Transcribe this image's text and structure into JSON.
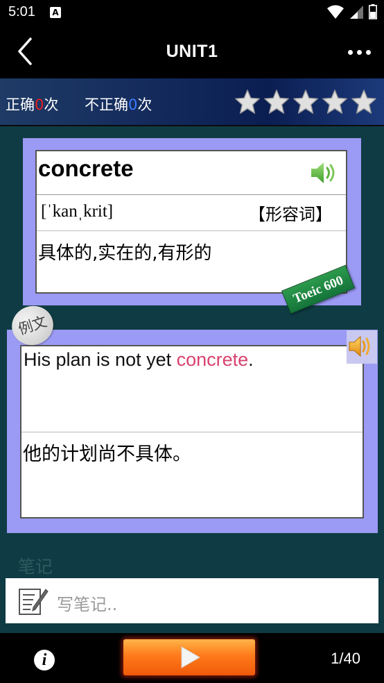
{
  "status_bar": {
    "time": "5:01",
    "notification_letter": "A"
  },
  "app_bar": {
    "title": "UNIT1"
  },
  "score": {
    "correct_prefix": "正确",
    "correct_count": "0",
    "correct_suffix": "次",
    "incorrect_prefix": "不正确",
    "incorrect_count": "0",
    "incorrect_suffix": "次",
    "stars_total": 5,
    "stars_filled": 5,
    "star_color": "#e0e0e0"
  },
  "word_card": {
    "word": "concrete",
    "phonetic": "[ˈkanˌkrit]",
    "part_of_speech": "【形容词】",
    "meaning": "具体的,实在的,有形的",
    "badge": "Toeic 600",
    "card_color": "#9b9af5"
  },
  "example": {
    "badge": "例文",
    "en_before": "His plan is not yet ",
    "en_highlight": "concrete",
    "en_after": ".",
    "cn": "他的计划尚不具体。",
    "highlight_color": "#d8426e"
  },
  "notes": {
    "label": "笔记",
    "placeholder": "写笔记.."
  },
  "bottom_bar": {
    "info_label": "i",
    "page_counter": "1/40"
  }
}
